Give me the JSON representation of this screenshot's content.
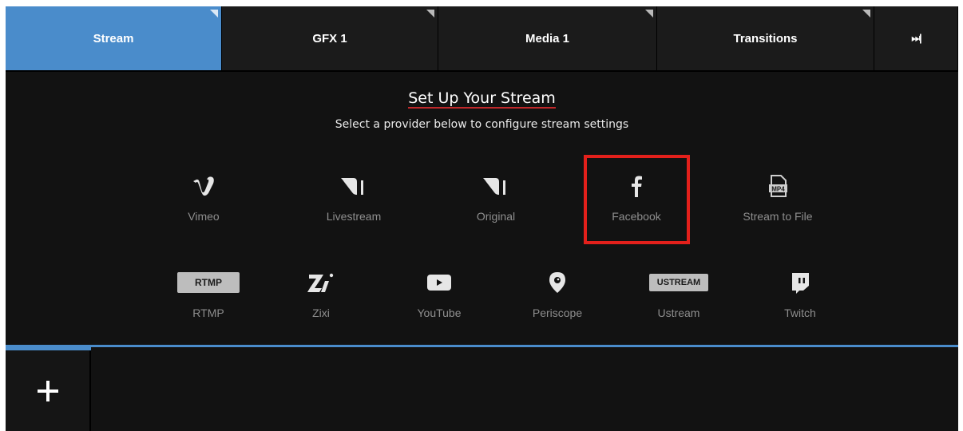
{
  "tabs": [
    {
      "label": "Stream",
      "active": true
    },
    {
      "label": "GFX 1",
      "active": false
    },
    {
      "label": "Media 1",
      "active": false
    },
    {
      "label": "Transitions",
      "active": false
    }
  ],
  "tab_skip_label": "⏭|",
  "setup": {
    "title": "Set Up Your Stream",
    "subtitle": "Select a provider below to configure stream settings"
  },
  "providers_row1": [
    {
      "name": "Vimeo",
      "icon": "vimeo-icon"
    },
    {
      "name": "Livestream",
      "icon": "livestream-icon"
    },
    {
      "name": "Original",
      "icon": "livestream-icon"
    },
    {
      "name": "Facebook",
      "icon": "facebook-icon",
      "highlighted": true
    },
    {
      "name": "Stream to File",
      "icon": "mp4-file-icon"
    }
  ],
  "providers_row2": [
    {
      "name": "RTMP",
      "icon": "rtmp-badge",
      "badge": "RTMP"
    },
    {
      "name": "Zixi",
      "icon": "zixi-icon"
    },
    {
      "name": "YouTube",
      "icon": "youtube-icon"
    },
    {
      "name": "Periscope",
      "icon": "periscope-icon"
    },
    {
      "name": "Ustream",
      "icon": "ustream-badge",
      "badge": "USTREAM"
    },
    {
      "name": "Twitch",
      "icon": "twitch-icon"
    }
  ],
  "mp4_badge": "MP4",
  "colors": {
    "accent": "#4a8ccb",
    "highlight": "#e3201b",
    "title_underline": "#c0282a",
    "background": "#121212"
  }
}
